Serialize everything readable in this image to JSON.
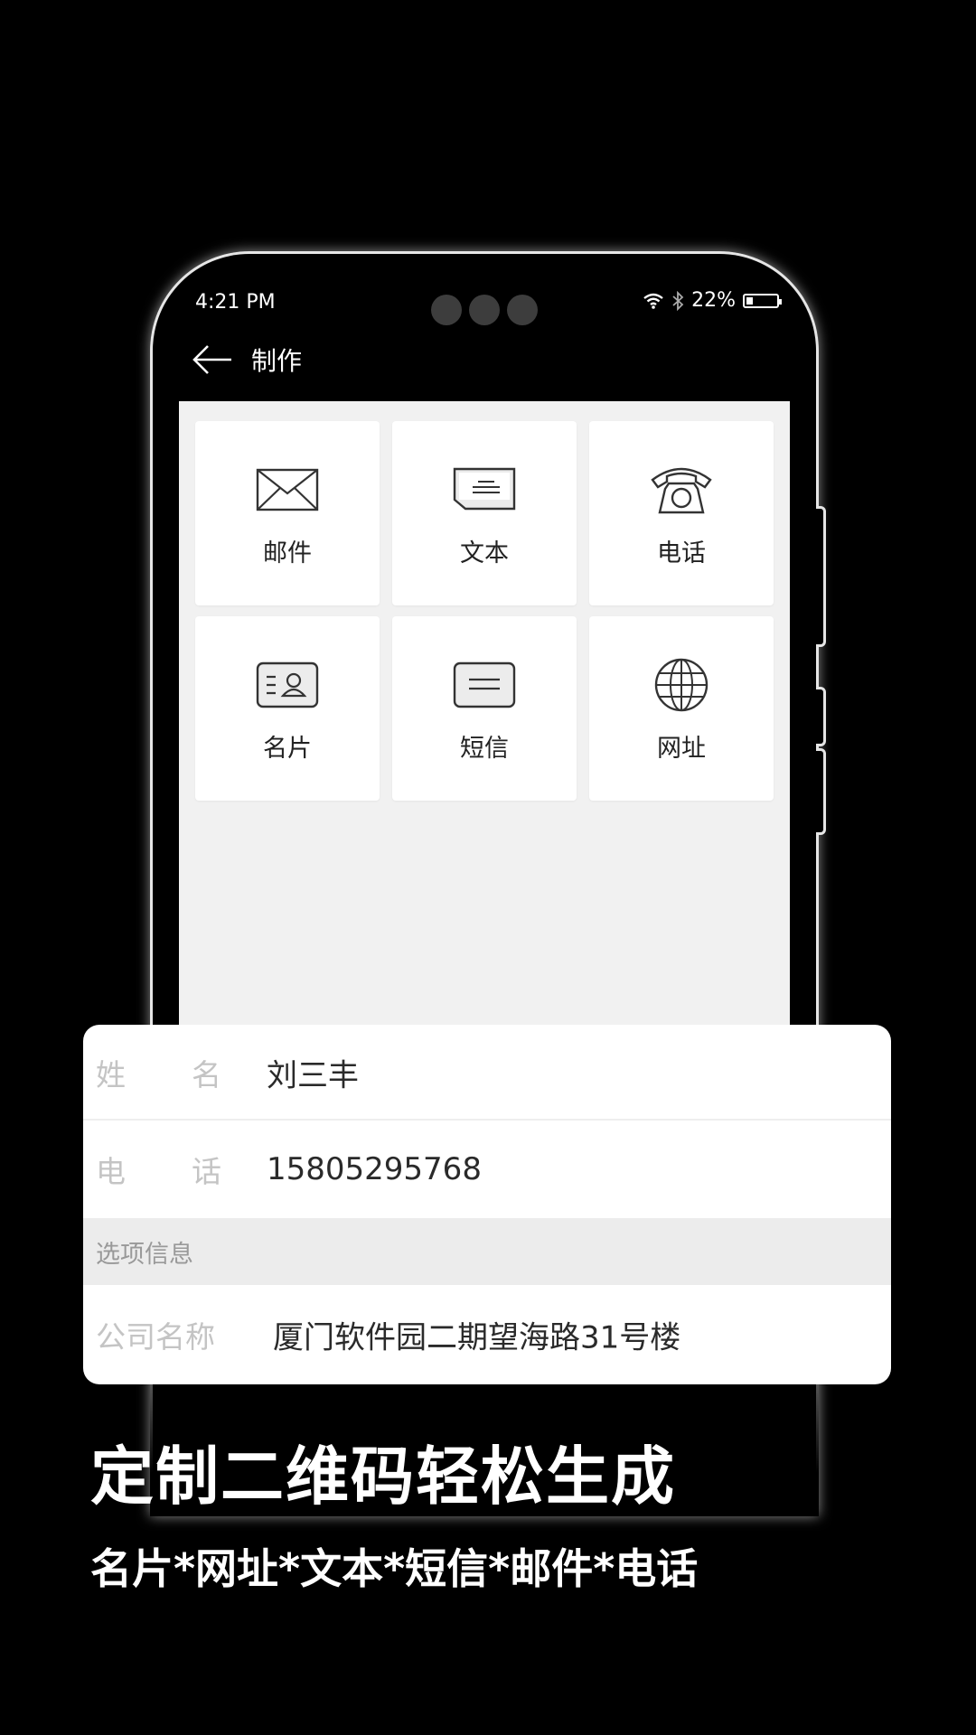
{
  "status_bar": {
    "time": "4:21 PM",
    "battery": "22%"
  },
  "header": {
    "title": "制作"
  },
  "tiles": [
    {
      "label": "邮件",
      "icon": "envelope-icon"
    },
    {
      "label": "文本",
      "icon": "text-note-icon"
    },
    {
      "label": "电话",
      "icon": "telephone-icon"
    },
    {
      "label": "名片",
      "icon": "business-card-icon"
    },
    {
      "label": "短信",
      "icon": "sms-icon"
    },
    {
      "label": "网址",
      "icon": "globe-icon"
    }
  ],
  "form": {
    "name_label_1": "姓",
    "name_label_2": "名",
    "name_value": "刘三丰",
    "phone_label_1": "电",
    "phone_label_2": "话",
    "phone_value": "15805295768",
    "section_label": "选项信息",
    "company_label": "公司名称",
    "company_value": "厦门软件园二期望海路31号楼"
  },
  "promo": {
    "headline": "定制二维码轻松生成",
    "subline": "名片*网址*文本*短信*邮件*电话"
  }
}
